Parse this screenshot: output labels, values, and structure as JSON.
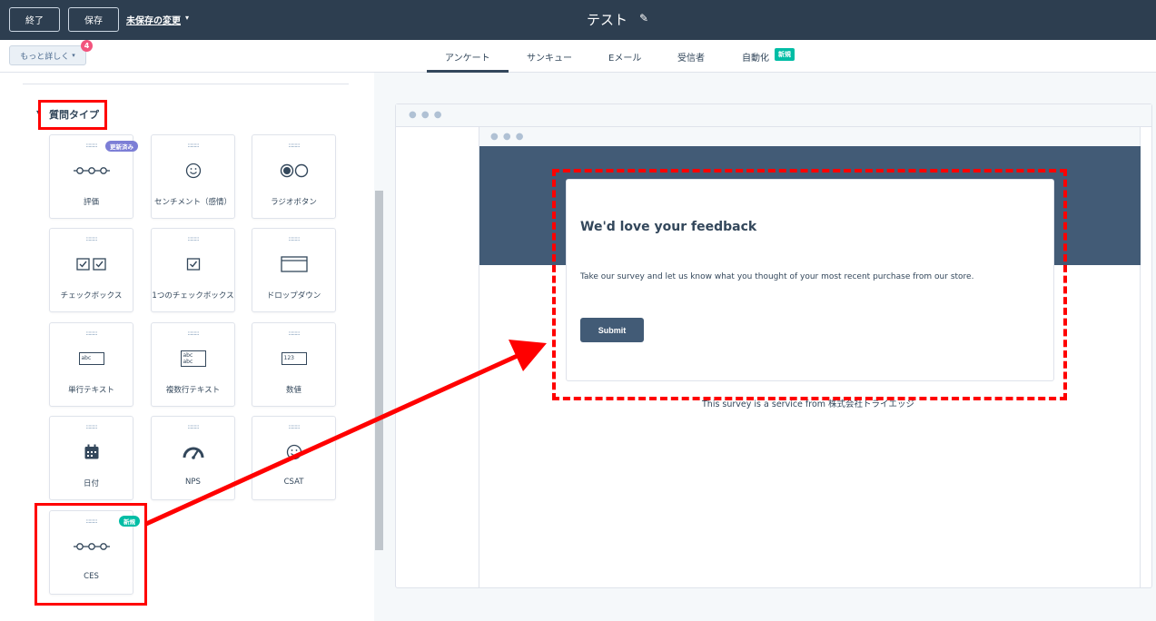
{
  "topbar": {
    "exit_label": "終了",
    "save_label": "保存",
    "unsaved_label": "未保存の変更",
    "title": "テスト"
  },
  "navbar": {
    "more_label": "もっと詳しく",
    "more_count": "4",
    "tabs": [
      {
        "label": "アンケート"
      },
      {
        "label": "サンキュー"
      },
      {
        "label": "Eメール"
      },
      {
        "label": "受信者"
      },
      {
        "label": "自動化"
      }
    ],
    "new_badge": "新規"
  },
  "panel": {
    "section_title": "質問タイプ",
    "grip": ":::::::::",
    "cards": [
      {
        "label": "評価",
        "icon": "rating-icon",
        "badge": "更新済み"
      },
      {
        "label": "センチメント（感情）",
        "icon": "smiley-icon"
      },
      {
        "label": "ラジオボタン",
        "icon": "radio-icon"
      },
      {
        "label": "チェックボックス",
        "icon": "checkboxes-icon"
      },
      {
        "label": "1つのチェックボックス",
        "icon": "checkbox-icon"
      },
      {
        "label": "ドロップダウン",
        "icon": "dropdown-icon"
      },
      {
        "label": "単行テキスト",
        "icon": "single-line-text-icon",
        "sample": "abc"
      },
      {
        "label": "複数行テキスト",
        "icon": "multi-line-text-icon",
        "sample1": "abc",
        "sample2": "abc"
      },
      {
        "label": "数値",
        "icon": "number-icon",
        "sample": "123"
      },
      {
        "label": "日付",
        "icon": "calendar-icon"
      },
      {
        "label": "NPS",
        "icon": "gauge-icon"
      },
      {
        "label": "CSAT",
        "icon": "csat-icon"
      },
      {
        "label": "CES",
        "icon": "ces-icon",
        "badge": "新規"
      }
    ]
  },
  "preview": {
    "dots": "● ● ●",
    "title": "We'd love your feedback",
    "text": "Take our survey and let us know what you thought of your most recent purchase from our store.",
    "submit_label": "Submit",
    "footer": "This survey is a service from 株式会社トライエッジ"
  },
  "colors": {
    "topbar": "#2d3e50",
    "hero": "#425b76",
    "accent_new": "#00bda5",
    "accent_updated": "#7c7ed6",
    "count_badge": "#f2547d",
    "annotation": "#ff0000"
  }
}
